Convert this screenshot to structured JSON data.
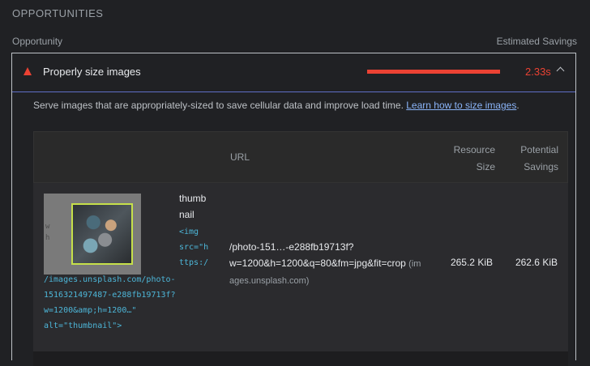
{
  "section": {
    "title": "OPPORTUNITIES"
  },
  "columns": {
    "opportunity": "Opportunity",
    "estimated_savings": "Estimated Savings"
  },
  "audit": {
    "title": "Properly size images",
    "savings": "2.33s",
    "savings_fraction": 1.0,
    "description": "Serve images that are appropriately-sized to save cellular data and improve load time. ",
    "learn_link": "Learn how to size images",
    "description_end": ".",
    "colors": {
      "fail": "#eb4233",
      "link": "#8ab4f8",
      "code": "#4db6d8",
      "highlight": "#c6e04a"
    },
    "table": {
      "headers": {
        "url": "URL",
        "resource_size": "Resource\nSize",
        "potential_savings": "Potential\nSavings"
      },
      "rows": [
        {
          "thumb_letters": "w\nh",
          "node_name": "thumbnail",
          "snippet_part1": "<img\nsrc=\"h\nttps:/",
          "snippet_part2": "/images.unsplash.com/photo-\n1516321497487-e288fb19713f?\nw=1200&amp;h=1200…\"\nalt=\"thumbnail\">",
          "url_path": "/photo-151…-e288fb19713f?\nw=1200&h=1200&q=80&fm=jpg&fit=crop",
          "url_host_part1": "(im",
          "url_host_part2": "ages.unsplash.com)",
          "resource_size": "265.2 KiB",
          "potential_savings": "262.6 KiB"
        }
      ]
    }
  }
}
